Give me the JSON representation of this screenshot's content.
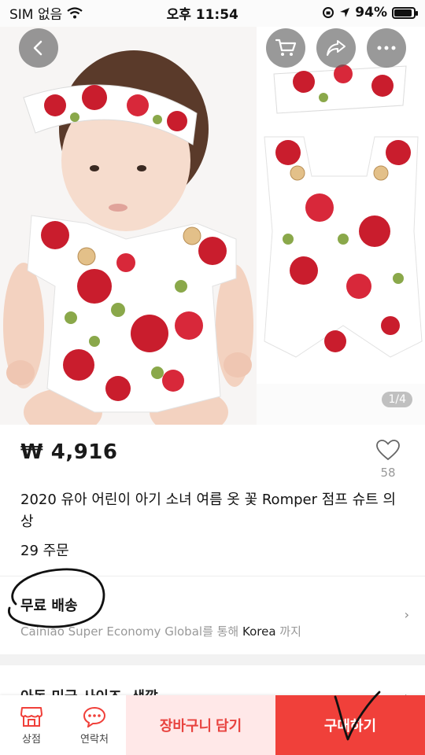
{
  "status_bar": {
    "carrier": "SIM 없음",
    "time": "오후 11:54",
    "battery": "94%",
    "battery_level": 0.94
  },
  "gallery": {
    "counter": "1/4",
    "back_icon": "chevron-left-icon",
    "cart_icon": "cart-icon",
    "share_icon": "share-icon",
    "more_icon": "more-icon"
  },
  "product": {
    "price": "₩ 4,916",
    "wishlist_count": "58",
    "title": "2020 유아 어린이 아기 소녀 여름 옷 꽃 Romper 점프 슈트 의상",
    "orders": "29 주문"
  },
  "shipping": {
    "title": "무료 배송",
    "provider": "Cainiao Super Economy Global",
    "via_text": "를 통해 ",
    "country": "Korea",
    "suffix": " 까지"
  },
  "options": {
    "title": "아동 미국 사이즈, 색깔"
  },
  "bottom_bar": {
    "store_label": "상점",
    "contact_label": "연락처",
    "add_to_cart_label": "장바구니 담기",
    "buy_now_label": "구매하기"
  },
  "colors": {
    "accent": "#f0403a",
    "cart_button_bg": "#ffe8e8",
    "cart_button_text": "#e8433f"
  }
}
